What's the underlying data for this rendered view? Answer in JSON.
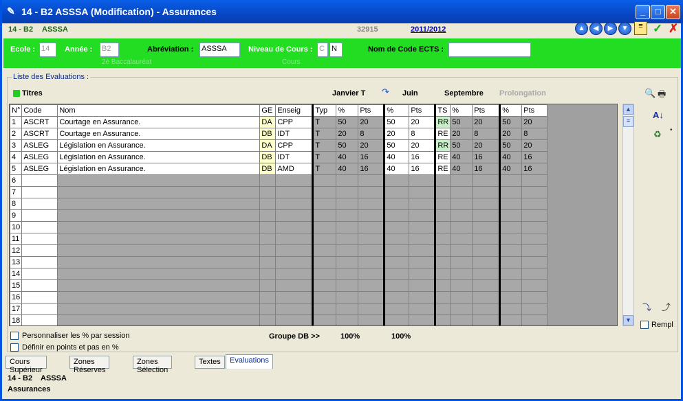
{
  "window": {
    "title": "14 - B2    ASSSA (Modification) - Assurances",
    "minimize": "_",
    "maximize": "□",
    "close": "✕"
  },
  "header": {
    "code": "14 - B2",
    "abbr": "ASSSA",
    "number": "32915",
    "year": "2011/2012"
  },
  "toolbar": {
    "ok": "✓",
    "cancel": "✗"
  },
  "form": {
    "ecole_label": "Ecole :",
    "ecole_value": "14",
    "annee_label": "Année :",
    "annee_value": "B2",
    "annee_sub": "2è Baccalauréat",
    "abrev_label": "Abréviation :",
    "abrev_value": "ASSSA",
    "niveau_label": "Niveau de Cours :",
    "niveau_value1": "C",
    "niveau_value2": "N",
    "niveau_sub": "Cours",
    "ects_label": "Nom de Code ECTS :",
    "ects_value": ""
  },
  "group": {
    "label": "Liste des Evaluations :",
    "titres": "Titres",
    "sessions": [
      "Janvier T",
      "Juin",
      "Septembre",
      "Prolongation"
    ]
  },
  "table": {
    "headers": [
      "N°",
      "Code",
      "Nom",
      "GE",
      "Enseig",
      "Typ",
      "%",
      "Pts",
      "%",
      "Pts",
      "TS",
      "%",
      "Pts",
      "%",
      "Pts"
    ],
    "rows": [
      {
        "n": "1",
        "code": "ASCRT",
        "nom": "Courtage en Assurance.",
        "ge": "DA",
        "ens": "CPP",
        "typ": "T",
        "p1": "50",
        "pt1": "20",
        "p2": "50",
        "pt2": "20",
        "ts": "RR",
        "p3": "50",
        "pt3": "20",
        "p4": "50",
        "pt4": "20"
      },
      {
        "n": "2",
        "code": "ASCRT",
        "nom": "Courtage en Assurance.",
        "ge": "DB",
        "ens": "IDT",
        "typ": "T",
        "p1": "20",
        "pt1": "8",
        "p2": "20",
        "pt2": "8",
        "ts": "RE",
        "p3": "20",
        "pt3": "8",
        "p4": "20",
        "pt4": "8"
      },
      {
        "n": "3",
        "code": "ASLEG",
        "nom": "Législation en Assurance.",
        "ge": "DA",
        "ens": "CPP",
        "typ": "T",
        "p1": "50",
        "pt1": "20",
        "p2": "50",
        "pt2": "20",
        "ts": "RR",
        "p3": "50",
        "pt3": "20",
        "p4": "50",
        "pt4": "20"
      },
      {
        "n": "4",
        "code": "ASLEG",
        "nom": "Législation en Assurance.",
        "ge": "DB",
        "ens": "IDT",
        "typ": "T",
        "p1": "40",
        "pt1": "16",
        "p2": "40",
        "pt2": "16",
        "ts": "RE",
        "p3": "40",
        "pt3": "16",
        "p4": "40",
        "pt4": "16"
      },
      {
        "n": "5",
        "code": "ASLEG",
        "nom": "Législation en Assurance.",
        "ge": "DB",
        "ens": "AMD",
        "typ": "T",
        "p1": "40",
        "pt1": "16",
        "p2": "40",
        "pt2": "16",
        "ts": "RE",
        "p3": "40",
        "pt3": "16",
        "p4": "40",
        "pt4": "16"
      }
    ],
    "empty_rows": [
      "6",
      "7",
      "8",
      "9",
      "10",
      "11",
      "12",
      "13",
      "14",
      "15",
      "16",
      "17",
      "18"
    ]
  },
  "bottom": {
    "perso": "Personnaliser les % par session",
    "points": "Définir en points et pas en %",
    "groupe": "Groupe DB >>",
    "pct1": "100%",
    "pct2": "100%",
    "rempl": "Rempl"
  },
  "tabs": [
    "Cours Supérieur",
    "Zones Réserves",
    "Zones Sélection",
    "Textes",
    "Evaluations"
  ],
  "footer": {
    "line1_code": "14 - B2",
    "line1_abbr": "ASSSA",
    "line2": "Assurances"
  }
}
